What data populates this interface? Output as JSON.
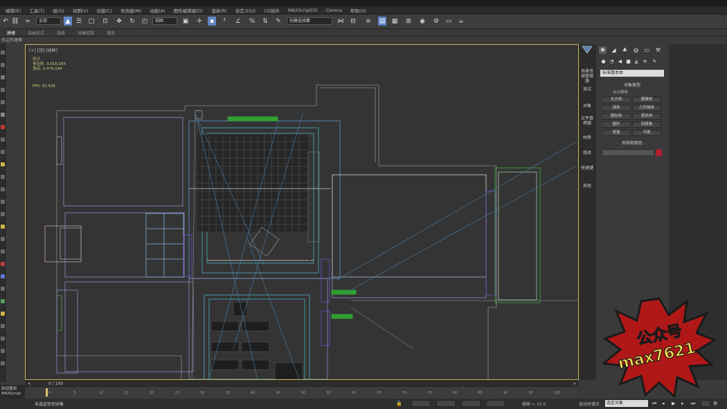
{
  "menubar": {
    "items": [
      "编辑(E)",
      "工具(T)",
      "组(G)",
      "视图(V)",
      "创建(C)",
      "修改器(M)",
      "动画(A)",
      "图形编辑器(D)",
      "渲染(R)",
      "自定义(U)",
      "CG插件",
      "MAXScript(X)",
      "Corona",
      "帮助(H)"
    ]
  },
  "toolbar": {
    "layer_select": "全部",
    "coord_select": "视图",
    "selection_set": "创建选择集"
  },
  "ribbon": {
    "tabs": [
      "建模",
      "自由形式",
      "选择",
      "对象绘制",
      "填充"
    ],
    "subtitle": "多边形建模"
  },
  "viewport": {
    "label": "[+] [顶] [线框]",
    "stats_title": "总计",
    "stat_polys": "多边形: 3,616,165",
    "stat_verts": "顶点: 2,479,194",
    "fps": "FPS: 32.426"
  },
  "command_tabs": [
    "场景资源管理器",
    "测试",
    "对象",
    "文件管理器",
    "材质",
    "修改",
    "快速键",
    "其他"
  ],
  "command_panel": {
    "dropdown": "标准基本体",
    "rollout_object_type": "对象类型",
    "autogrid": "自动栅格",
    "object_buttons": [
      "长方体",
      "圆锥体",
      "球体",
      "几何球体",
      "圆柱体",
      "管状体",
      "圆环",
      "四棱锥",
      "茶壶",
      "平面"
    ],
    "rollout_name_color": "名称和颜色"
  },
  "timeline": {
    "frame": "0 / 100",
    "ticks": [
      "0",
      "5",
      "10",
      "15",
      "20",
      "25",
      "30",
      "35",
      "40",
      "45",
      "50",
      "55",
      "60",
      "65",
      "70",
      "75",
      "80",
      "85",
      "90",
      "95",
      "100"
    ]
  },
  "maxscript": {
    "line1": "欢迎使用",
    "line2": "MAXScript"
  },
  "status": {
    "selection": "未选定任何对象",
    "grid": "栅格 = 10.0",
    "autokey": "自动关键点",
    "key_filter": "选定对象"
  },
  "watermark": {
    "line1": "公众号",
    "line2": "max7621"
  },
  "colors": {
    "selection_swatch": "#b01c30",
    "viewport_border": "#c8b85a",
    "active_tool": "#5f86c4"
  }
}
